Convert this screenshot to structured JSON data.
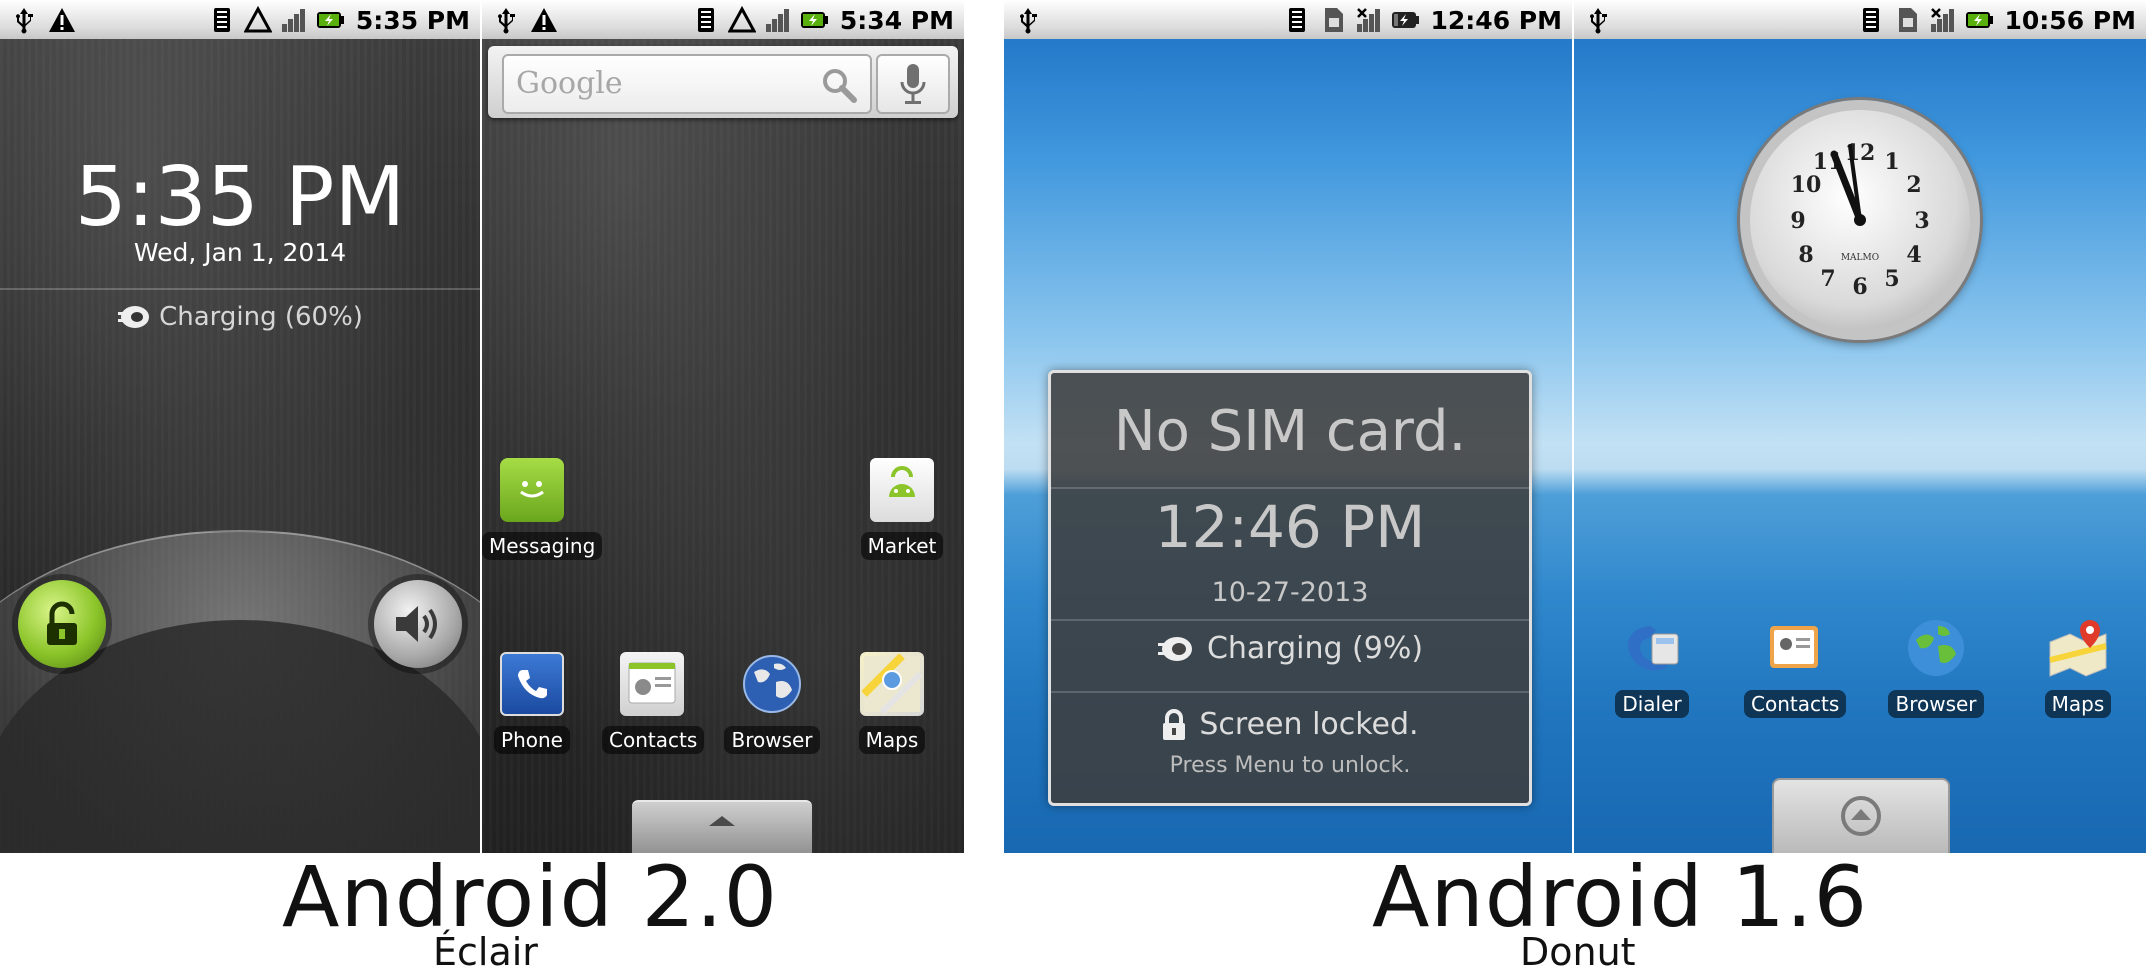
{
  "screens": {
    "eclair_lock": {
      "status_time": "5:35 PM",
      "time": "5:35 PM",
      "date": "Wed, Jan 1, 2014",
      "charging": "Charging (60%)"
    },
    "eclair_home": {
      "status_time": "5:34 PM",
      "search_placeholder": "Google",
      "apps": [
        "Messaging",
        "Market",
        "Phone",
        "Contacts",
        "Browser",
        "Maps"
      ]
    },
    "donut_lock": {
      "status_time": "12:46 PM",
      "sim_message": "No SIM card.",
      "time": "12:46 PM",
      "date": "10-27-2013",
      "charging": "Charging (9%)",
      "locked": "Screen locked.",
      "hint": "Press Menu to unlock."
    },
    "donut_home": {
      "status_time": "10:56 PM",
      "clock_brand": "MALMO",
      "clock_numbers": [
        "12",
        "1",
        "2",
        "3",
        "4",
        "5",
        "6",
        "7",
        "8",
        "9",
        "10",
        "11"
      ],
      "apps": [
        "Dialer",
        "Contacts",
        "Browser",
        "Maps"
      ]
    }
  },
  "captions": {
    "left_title": "Android 2.0",
    "left_subtitle": "Éclair",
    "right_title": "Android 1.6",
    "right_subtitle": "Donut"
  },
  "colors": {
    "eclair_accent": "#8cc52a",
    "donut_panel": "#3e3e3e"
  }
}
